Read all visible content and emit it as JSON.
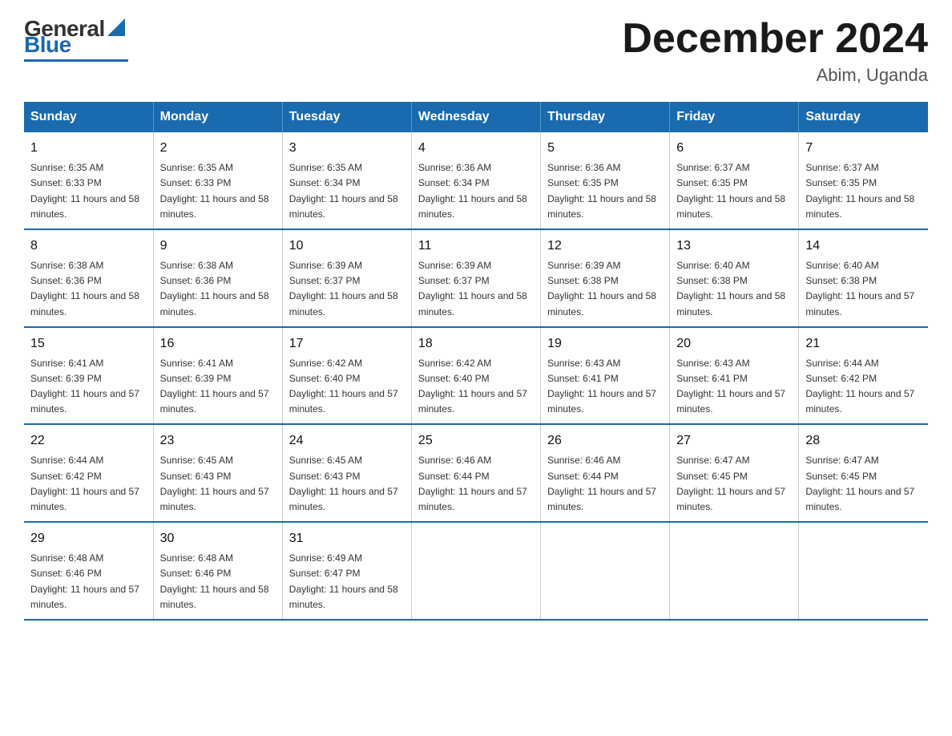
{
  "header": {
    "logo_general": "General",
    "logo_blue": "Blue",
    "month_title": "December 2024",
    "location": "Abim, Uganda"
  },
  "days_of_week": [
    "Sunday",
    "Monday",
    "Tuesday",
    "Wednesday",
    "Thursday",
    "Friday",
    "Saturday"
  ],
  "weeks": [
    [
      {
        "day": "1",
        "sunrise": "Sunrise: 6:35 AM",
        "sunset": "Sunset: 6:33 PM",
        "daylight": "Daylight: 11 hours and 58 minutes."
      },
      {
        "day": "2",
        "sunrise": "Sunrise: 6:35 AM",
        "sunset": "Sunset: 6:33 PM",
        "daylight": "Daylight: 11 hours and 58 minutes."
      },
      {
        "day": "3",
        "sunrise": "Sunrise: 6:35 AM",
        "sunset": "Sunset: 6:34 PM",
        "daylight": "Daylight: 11 hours and 58 minutes."
      },
      {
        "day": "4",
        "sunrise": "Sunrise: 6:36 AM",
        "sunset": "Sunset: 6:34 PM",
        "daylight": "Daylight: 11 hours and 58 minutes."
      },
      {
        "day": "5",
        "sunrise": "Sunrise: 6:36 AM",
        "sunset": "Sunset: 6:35 PM",
        "daylight": "Daylight: 11 hours and 58 minutes."
      },
      {
        "day": "6",
        "sunrise": "Sunrise: 6:37 AM",
        "sunset": "Sunset: 6:35 PM",
        "daylight": "Daylight: 11 hours and 58 minutes."
      },
      {
        "day": "7",
        "sunrise": "Sunrise: 6:37 AM",
        "sunset": "Sunset: 6:35 PM",
        "daylight": "Daylight: 11 hours and 58 minutes."
      }
    ],
    [
      {
        "day": "8",
        "sunrise": "Sunrise: 6:38 AM",
        "sunset": "Sunset: 6:36 PM",
        "daylight": "Daylight: 11 hours and 58 minutes."
      },
      {
        "day": "9",
        "sunrise": "Sunrise: 6:38 AM",
        "sunset": "Sunset: 6:36 PM",
        "daylight": "Daylight: 11 hours and 58 minutes."
      },
      {
        "day": "10",
        "sunrise": "Sunrise: 6:39 AM",
        "sunset": "Sunset: 6:37 PM",
        "daylight": "Daylight: 11 hours and 58 minutes."
      },
      {
        "day": "11",
        "sunrise": "Sunrise: 6:39 AM",
        "sunset": "Sunset: 6:37 PM",
        "daylight": "Daylight: 11 hours and 58 minutes."
      },
      {
        "day": "12",
        "sunrise": "Sunrise: 6:39 AM",
        "sunset": "Sunset: 6:38 PM",
        "daylight": "Daylight: 11 hours and 58 minutes."
      },
      {
        "day": "13",
        "sunrise": "Sunrise: 6:40 AM",
        "sunset": "Sunset: 6:38 PM",
        "daylight": "Daylight: 11 hours and 58 minutes."
      },
      {
        "day": "14",
        "sunrise": "Sunrise: 6:40 AM",
        "sunset": "Sunset: 6:38 PM",
        "daylight": "Daylight: 11 hours and 57 minutes."
      }
    ],
    [
      {
        "day": "15",
        "sunrise": "Sunrise: 6:41 AM",
        "sunset": "Sunset: 6:39 PM",
        "daylight": "Daylight: 11 hours and 57 minutes."
      },
      {
        "day": "16",
        "sunrise": "Sunrise: 6:41 AM",
        "sunset": "Sunset: 6:39 PM",
        "daylight": "Daylight: 11 hours and 57 minutes."
      },
      {
        "day": "17",
        "sunrise": "Sunrise: 6:42 AM",
        "sunset": "Sunset: 6:40 PM",
        "daylight": "Daylight: 11 hours and 57 minutes."
      },
      {
        "day": "18",
        "sunrise": "Sunrise: 6:42 AM",
        "sunset": "Sunset: 6:40 PM",
        "daylight": "Daylight: 11 hours and 57 minutes."
      },
      {
        "day": "19",
        "sunrise": "Sunrise: 6:43 AM",
        "sunset": "Sunset: 6:41 PM",
        "daylight": "Daylight: 11 hours and 57 minutes."
      },
      {
        "day": "20",
        "sunrise": "Sunrise: 6:43 AM",
        "sunset": "Sunset: 6:41 PM",
        "daylight": "Daylight: 11 hours and 57 minutes."
      },
      {
        "day": "21",
        "sunrise": "Sunrise: 6:44 AM",
        "sunset": "Sunset: 6:42 PM",
        "daylight": "Daylight: 11 hours and 57 minutes."
      }
    ],
    [
      {
        "day": "22",
        "sunrise": "Sunrise: 6:44 AM",
        "sunset": "Sunset: 6:42 PM",
        "daylight": "Daylight: 11 hours and 57 minutes."
      },
      {
        "day": "23",
        "sunrise": "Sunrise: 6:45 AM",
        "sunset": "Sunset: 6:43 PM",
        "daylight": "Daylight: 11 hours and 57 minutes."
      },
      {
        "day": "24",
        "sunrise": "Sunrise: 6:45 AM",
        "sunset": "Sunset: 6:43 PM",
        "daylight": "Daylight: 11 hours and 57 minutes."
      },
      {
        "day": "25",
        "sunrise": "Sunrise: 6:46 AM",
        "sunset": "Sunset: 6:44 PM",
        "daylight": "Daylight: 11 hours and 57 minutes."
      },
      {
        "day": "26",
        "sunrise": "Sunrise: 6:46 AM",
        "sunset": "Sunset: 6:44 PM",
        "daylight": "Daylight: 11 hours and 57 minutes."
      },
      {
        "day": "27",
        "sunrise": "Sunrise: 6:47 AM",
        "sunset": "Sunset: 6:45 PM",
        "daylight": "Daylight: 11 hours and 57 minutes."
      },
      {
        "day": "28",
        "sunrise": "Sunrise: 6:47 AM",
        "sunset": "Sunset: 6:45 PM",
        "daylight": "Daylight: 11 hours and 57 minutes."
      }
    ],
    [
      {
        "day": "29",
        "sunrise": "Sunrise: 6:48 AM",
        "sunset": "Sunset: 6:46 PM",
        "daylight": "Daylight: 11 hours and 57 minutes."
      },
      {
        "day": "30",
        "sunrise": "Sunrise: 6:48 AM",
        "sunset": "Sunset: 6:46 PM",
        "daylight": "Daylight: 11 hours and 58 minutes."
      },
      {
        "day": "31",
        "sunrise": "Sunrise: 6:49 AM",
        "sunset": "Sunset: 6:47 PM",
        "daylight": "Daylight: 11 hours and 58 minutes."
      },
      null,
      null,
      null,
      null
    ]
  ]
}
